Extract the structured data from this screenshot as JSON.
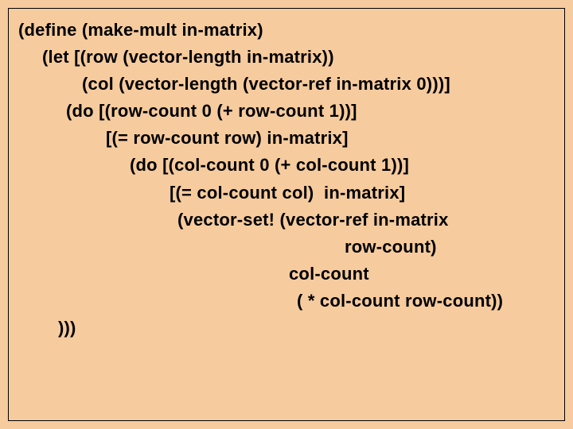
{
  "code": {
    "lines": [
      {
        "indent": 0,
        "text": "(define (make-mult in-matrix)"
      },
      {
        "indent": 30,
        "text": "(let [(row (vector-length in-matrix))"
      },
      {
        "indent": 80,
        "text": "(col (vector-length (vector-ref in-matrix 0)))]"
      },
      {
        "indent": 60,
        "text": "(do [(row-count 0 (+ row-count 1))]"
      },
      {
        "indent": 110,
        "text": "[(= row-count row) in-matrix]"
      },
      {
        "indent": 140,
        "text": "(do [(col-count 0 (+ col-count 1))]"
      },
      {
        "indent": 190,
        "text": "[(= col-count col)  in-matrix]"
      },
      {
        "indent": 200,
        "text": "(vector-set! (vector-ref in-matrix"
      },
      {
        "indent": 410,
        "text": "row-count)"
      },
      {
        "indent": 340,
        "text": "col-count"
      },
      {
        "indent": 350,
        "text": "( * col-count row-count))"
      },
      {
        "indent": 50,
        "text": ")))"
      }
    ]
  }
}
